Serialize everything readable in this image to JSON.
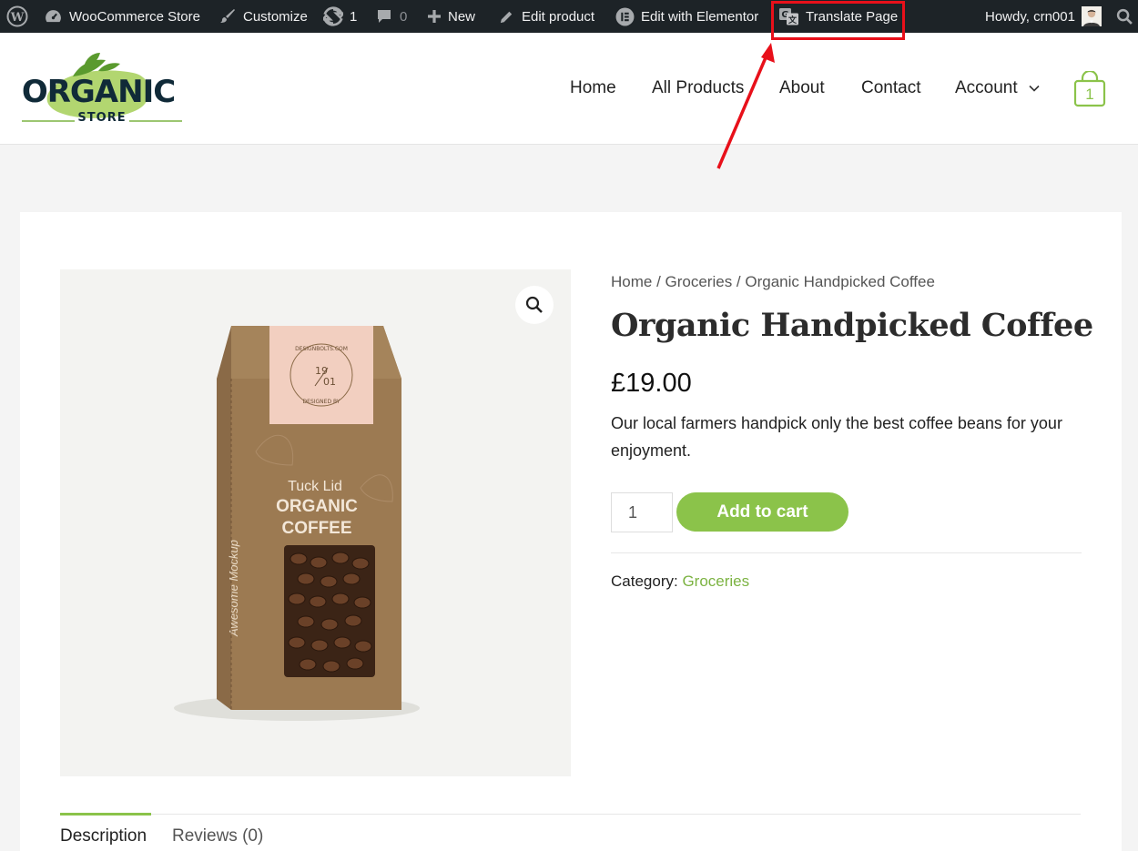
{
  "adminbar": {
    "site_name": "WooCommerce Store",
    "customize": "Customize",
    "updates_count": "1",
    "comments_count": "0",
    "new": "New",
    "edit_product": "Edit product",
    "edit_elementor": "Edit with Elementor",
    "translate": "Translate Page",
    "howdy": "Howdy, crn001"
  },
  "header": {
    "logo_main": "ORGANIC",
    "logo_sub": "STORE",
    "nav": {
      "home": "Home",
      "all_products": "All Products",
      "about": "About",
      "contact": "Contact",
      "account": "Account"
    },
    "cart_count": "1"
  },
  "product": {
    "image": {
      "label_line1": "19",
      "label_line2": "01",
      "label_ring_top": "DESIGNBOLTS.COM",
      "label_ring_bottom": "DESIGNED BY",
      "sub": "Tuck Lid",
      "name1": "ORGANIC",
      "name2": "COFFEE",
      "side": "Awesome Mockup"
    },
    "breadcrumb": "Home / Groceries / Organic Handpicked Coffee",
    "title": "Organic Handpicked Coffee",
    "price": "£19.00",
    "description": "Our local farmers handpick only the best coffee beans for your enjoyment.",
    "quantity": "1",
    "add_to_cart": "Add to cart",
    "category_label": "Category: ",
    "category": "Groceries",
    "tabs": {
      "description": "Description",
      "reviews": "Reviews (0)"
    }
  },
  "colors": {
    "accent": "#8bc34a",
    "adminbar": "#1d2327",
    "highlight": "#e8101a"
  }
}
